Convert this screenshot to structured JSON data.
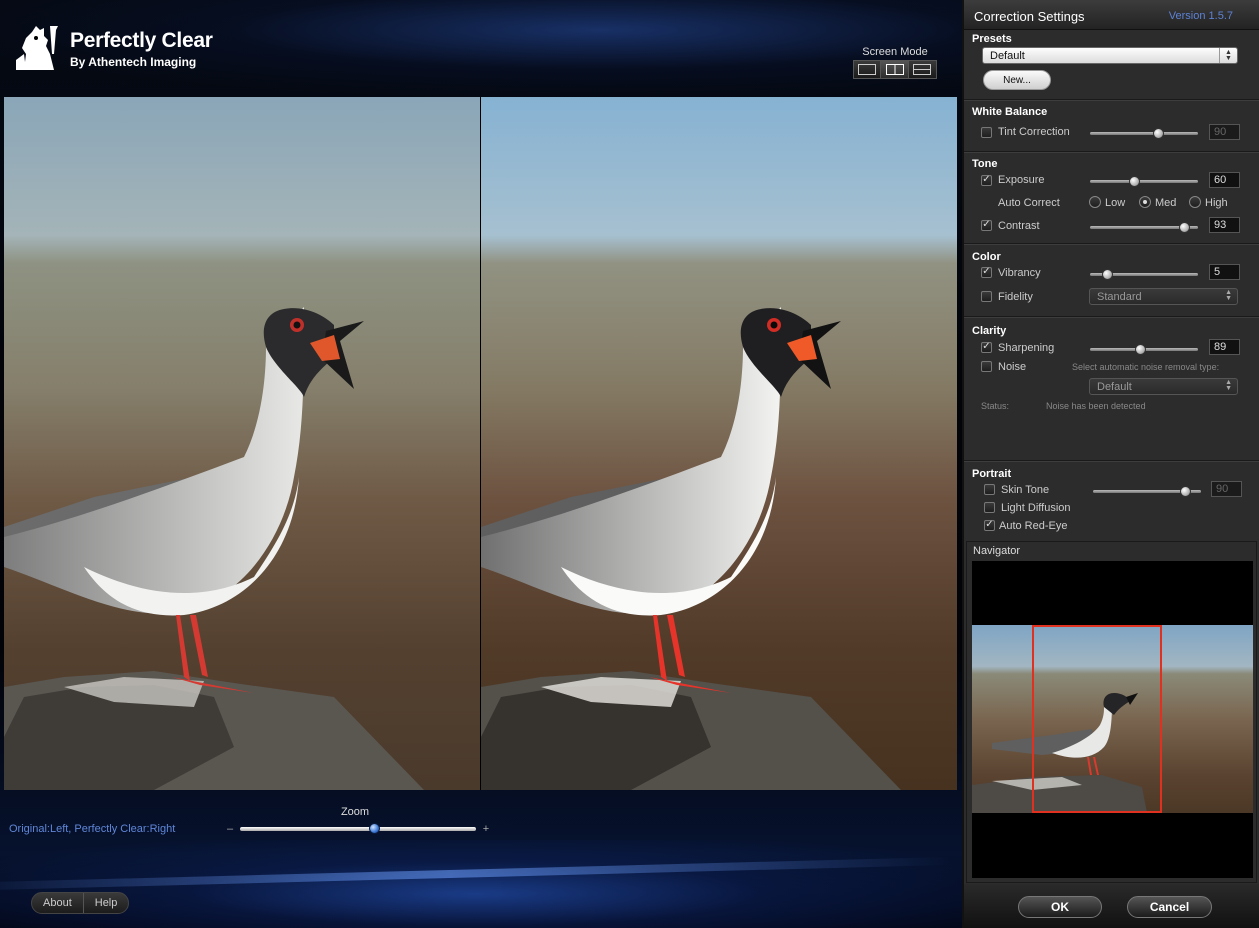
{
  "app": {
    "brand": "Perfectly Clear",
    "sub": "By Athentech Imaging"
  },
  "screen_mode": {
    "label": "Screen Mode",
    "modes": [
      "single-view-icon",
      "split-view-icon",
      "stacked-view-icon"
    ],
    "active": "split-view-icon"
  },
  "comparison_label": "Original:Left, Perfectly Clear:Right",
  "zoom": {
    "label": "Zoom",
    "minus": "–",
    "plus": "+",
    "level": 0.57
  },
  "buttons": {
    "about": "About",
    "help": "Help",
    "ok": "OK",
    "cancel": "Cancel",
    "new_preset": "New..."
  },
  "panel": {
    "title": "Correction Settings",
    "version": "Version 1.5.7",
    "presets": {
      "title": "Presets",
      "value": "Default"
    },
    "white_balance": {
      "title": "White Balance",
      "tint": {
        "label": "Tint Correction",
        "checked": false,
        "value": "90",
        "level": 0.63
      }
    },
    "tone": {
      "title": "Tone",
      "exposure": {
        "label": "Exposure",
        "checked": true,
        "value": "60",
        "level": 0.41
      },
      "auto_correct": {
        "label": "Auto Correct",
        "options": [
          "Low",
          "Med",
          "High"
        ],
        "selected": "Med"
      },
      "contrast": {
        "label": "Contrast",
        "checked": true,
        "value": "93",
        "level": 0.87
      }
    },
    "color": {
      "title": "Color",
      "vibrancy": {
        "label": "Vibrancy",
        "checked": true,
        "value": "5",
        "level": 0.16
      },
      "fidelity": {
        "label": "Fidelity",
        "checked": false,
        "value": "Standard"
      }
    },
    "clarity": {
      "title": "Clarity",
      "sharpening": {
        "label": "Sharpening",
        "checked": true,
        "value": "89",
        "level": 0.46
      },
      "noise": {
        "label": "Noise",
        "checked": false,
        "hint": "Select automatic noise removal type:",
        "value": "Default"
      },
      "status_label": "Status:",
      "status_text": "Noise has been detected"
    },
    "portrait": {
      "title": "Portrait",
      "skin_tone": {
        "label": "Skin Tone",
        "checked": false,
        "value": "90",
        "level": 0.85
      },
      "light_diffusion": {
        "label": "Light Diffusion",
        "checked": false
      },
      "auto_red_eye": {
        "label": "Auto Red-Eye",
        "checked": true
      }
    },
    "navigator": {
      "title": "Navigator"
    }
  },
  "colors": {
    "accent_blue": "#5d82d4",
    "nav_frame": "#e0301f",
    "panel_bg": "#2c2c2c"
  }
}
